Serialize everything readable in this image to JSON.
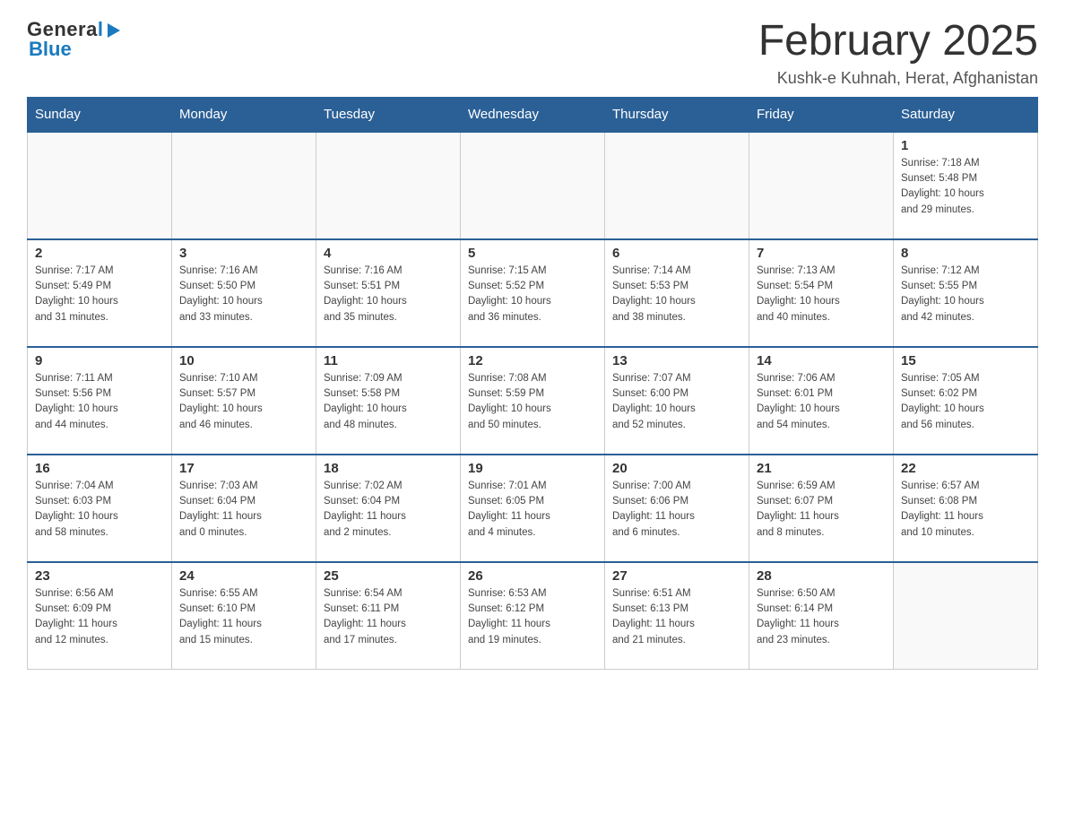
{
  "logo": {
    "general": "General",
    "blue": "Blue",
    "arrow": "▶"
  },
  "title": "February 2025",
  "subtitle": "Kushk-e Kuhnah, Herat, Afghanistan",
  "days_of_week": [
    "Sunday",
    "Monday",
    "Tuesday",
    "Wednesday",
    "Thursday",
    "Friday",
    "Saturday"
  ],
  "weeks": [
    [
      {
        "day": "",
        "info": ""
      },
      {
        "day": "",
        "info": ""
      },
      {
        "day": "",
        "info": ""
      },
      {
        "day": "",
        "info": ""
      },
      {
        "day": "",
        "info": ""
      },
      {
        "day": "",
        "info": ""
      },
      {
        "day": "1",
        "info": "Sunrise: 7:18 AM\nSunset: 5:48 PM\nDaylight: 10 hours\nand 29 minutes."
      }
    ],
    [
      {
        "day": "2",
        "info": "Sunrise: 7:17 AM\nSunset: 5:49 PM\nDaylight: 10 hours\nand 31 minutes."
      },
      {
        "day": "3",
        "info": "Sunrise: 7:16 AM\nSunset: 5:50 PM\nDaylight: 10 hours\nand 33 minutes."
      },
      {
        "day": "4",
        "info": "Sunrise: 7:16 AM\nSunset: 5:51 PM\nDaylight: 10 hours\nand 35 minutes."
      },
      {
        "day": "5",
        "info": "Sunrise: 7:15 AM\nSunset: 5:52 PM\nDaylight: 10 hours\nand 36 minutes."
      },
      {
        "day": "6",
        "info": "Sunrise: 7:14 AM\nSunset: 5:53 PM\nDaylight: 10 hours\nand 38 minutes."
      },
      {
        "day": "7",
        "info": "Sunrise: 7:13 AM\nSunset: 5:54 PM\nDaylight: 10 hours\nand 40 minutes."
      },
      {
        "day": "8",
        "info": "Sunrise: 7:12 AM\nSunset: 5:55 PM\nDaylight: 10 hours\nand 42 minutes."
      }
    ],
    [
      {
        "day": "9",
        "info": "Sunrise: 7:11 AM\nSunset: 5:56 PM\nDaylight: 10 hours\nand 44 minutes."
      },
      {
        "day": "10",
        "info": "Sunrise: 7:10 AM\nSunset: 5:57 PM\nDaylight: 10 hours\nand 46 minutes."
      },
      {
        "day": "11",
        "info": "Sunrise: 7:09 AM\nSunset: 5:58 PM\nDaylight: 10 hours\nand 48 minutes."
      },
      {
        "day": "12",
        "info": "Sunrise: 7:08 AM\nSunset: 5:59 PM\nDaylight: 10 hours\nand 50 minutes."
      },
      {
        "day": "13",
        "info": "Sunrise: 7:07 AM\nSunset: 6:00 PM\nDaylight: 10 hours\nand 52 minutes."
      },
      {
        "day": "14",
        "info": "Sunrise: 7:06 AM\nSunset: 6:01 PM\nDaylight: 10 hours\nand 54 minutes."
      },
      {
        "day": "15",
        "info": "Sunrise: 7:05 AM\nSunset: 6:02 PM\nDaylight: 10 hours\nand 56 minutes."
      }
    ],
    [
      {
        "day": "16",
        "info": "Sunrise: 7:04 AM\nSunset: 6:03 PM\nDaylight: 10 hours\nand 58 minutes."
      },
      {
        "day": "17",
        "info": "Sunrise: 7:03 AM\nSunset: 6:04 PM\nDaylight: 11 hours\nand 0 minutes."
      },
      {
        "day": "18",
        "info": "Sunrise: 7:02 AM\nSunset: 6:04 PM\nDaylight: 11 hours\nand 2 minutes."
      },
      {
        "day": "19",
        "info": "Sunrise: 7:01 AM\nSunset: 6:05 PM\nDaylight: 11 hours\nand 4 minutes."
      },
      {
        "day": "20",
        "info": "Sunrise: 7:00 AM\nSunset: 6:06 PM\nDaylight: 11 hours\nand 6 minutes."
      },
      {
        "day": "21",
        "info": "Sunrise: 6:59 AM\nSunset: 6:07 PM\nDaylight: 11 hours\nand 8 minutes."
      },
      {
        "day": "22",
        "info": "Sunrise: 6:57 AM\nSunset: 6:08 PM\nDaylight: 11 hours\nand 10 minutes."
      }
    ],
    [
      {
        "day": "23",
        "info": "Sunrise: 6:56 AM\nSunset: 6:09 PM\nDaylight: 11 hours\nand 12 minutes."
      },
      {
        "day": "24",
        "info": "Sunrise: 6:55 AM\nSunset: 6:10 PM\nDaylight: 11 hours\nand 15 minutes."
      },
      {
        "day": "25",
        "info": "Sunrise: 6:54 AM\nSunset: 6:11 PM\nDaylight: 11 hours\nand 17 minutes."
      },
      {
        "day": "26",
        "info": "Sunrise: 6:53 AM\nSunset: 6:12 PM\nDaylight: 11 hours\nand 19 minutes."
      },
      {
        "day": "27",
        "info": "Sunrise: 6:51 AM\nSunset: 6:13 PM\nDaylight: 11 hours\nand 21 minutes."
      },
      {
        "day": "28",
        "info": "Sunrise: 6:50 AM\nSunset: 6:14 PM\nDaylight: 11 hours\nand 23 minutes."
      },
      {
        "day": "",
        "info": ""
      }
    ]
  ]
}
